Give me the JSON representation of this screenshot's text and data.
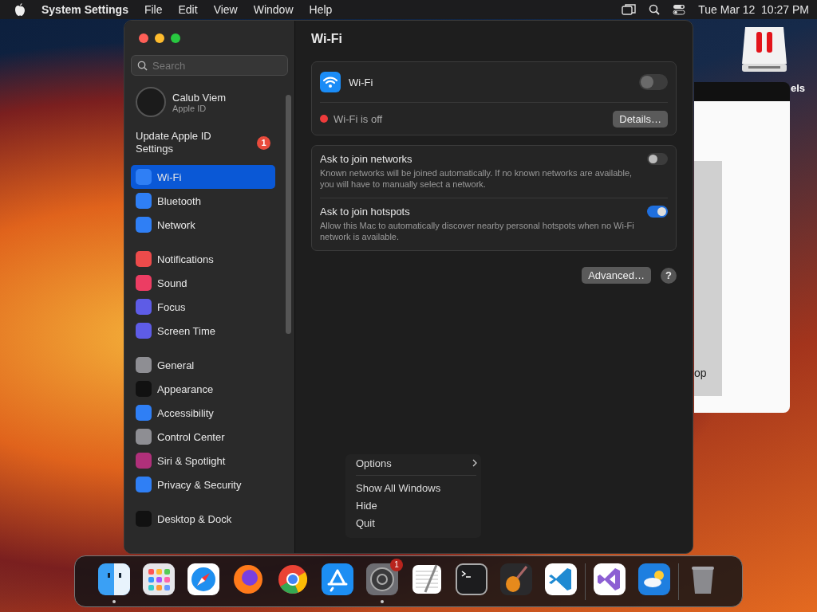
{
  "menu_bar": {
    "app_name": "System Settings",
    "menus": [
      "File",
      "Edit",
      "View",
      "Window",
      "Help"
    ],
    "clock": "Tue Mar 12  10:27 PM"
  },
  "desktop_icon": {
    "label": "els"
  },
  "background_window": {
    "caption": "op"
  },
  "window": {
    "sidebar": {
      "search": {
        "placeholder": "Search"
      },
      "account": {
        "name": "Calub Viem",
        "subtitle": "Apple ID"
      },
      "notice": {
        "text": "Update Apple ID Settings",
        "badge": "1"
      },
      "groups": [
        [
          {
            "label": "Wi-Fi",
            "selected": true,
            "color": "#2f7ff5"
          },
          {
            "label": "Bluetooth",
            "selected": false,
            "color": "#2f7ff5"
          },
          {
            "label": "Network",
            "selected": false,
            "color": "#2f7ff5"
          }
        ],
        [
          {
            "label": "Notifications",
            "selected": false,
            "color": "#ec4b4b"
          },
          {
            "label": "Sound",
            "selected": false,
            "color": "#ec3d63"
          },
          {
            "label": "Focus",
            "selected": false,
            "color": "#5e5ce6"
          },
          {
            "label": "Screen Time",
            "selected": false,
            "color": "#5e5ce6"
          }
        ],
        [
          {
            "label": "General",
            "selected": false,
            "color": "#8e8e93"
          },
          {
            "label": "Appearance",
            "selected": false,
            "color": "#111111"
          },
          {
            "label": "Accessibility",
            "selected": false,
            "color": "#2f7ff5"
          },
          {
            "label": "Control Center",
            "selected": false,
            "color": "#8e8e93"
          },
          {
            "label": "Siri & Spotlight",
            "selected": false,
            "color": "#b0307a"
          },
          {
            "label": "Privacy & Security",
            "selected": false,
            "color": "#2f7ff5"
          }
        ],
        [
          {
            "label": "Desktop & Dock",
            "selected": false,
            "color": "#111111"
          }
        ]
      ]
    },
    "content": {
      "title": "Wi-Fi",
      "wifi_card": {
        "label": "Wi-Fi",
        "on": false,
        "status": {
          "text": "Wi-Fi is off",
          "color": "#ee3b3b"
        },
        "button": "Details…"
      },
      "options": [
        {
          "title": "Ask to join networks",
          "description": "Known networks will be joined automatically. If no known networks are available, you will have to manually select a network.",
          "on": false
        },
        {
          "title": "Ask to join hotspots",
          "description": "Allow this Mac to automatically discover nearby personal hotspots when no Wi-Fi network is available.",
          "on": true
        }
      ],
      "advanced_button": "Advanced…",
      "help_button": "?"
    }
  },
  "context_menu": [
    {
      "label": "Options",
      "submenu": true
    },
    {
      "label": "Show All Windows",
      "submenu": false
    },
    {
      "label": "Hide",
      "submenu": false
    },
    {
      "label": "Quit",
      "submenu": false
    }
  ],
  "dock": {
    "sections": [
      [
        {
          "kind": "finder",
          "running": true
        },
        {
          "kind": "launchpad",
          "running": false
        },
        {
          "kind": "safari",
          "running": false
        },
        {
          "kind": "firefox",
          "running": false
        },
        {
          "kind": "chrome",
          "running": false
        },
        {
          "kind": "appstore",
          "running": false
        },
        {
          "kind": "settings",
          "running": true,
          "badge": "1"
        },
        {
          "kind": "textedit",
          "running": false
        },
        {
          "kind": "terminal",
          "running": false
        },
        {
          "kind": "garageband",
          "running": false
        },
        {
          "kind": "vscode",
          "running": false
        }
      ],
      [
        {
          "kind": "visualstudio",
          "running": false
        },
        {
          "kind": "weather",
          "running": false
        }
      ],
      [
        {
          "kind": "trash",
          "running": false
        }
      ]
    ]
  }
}
